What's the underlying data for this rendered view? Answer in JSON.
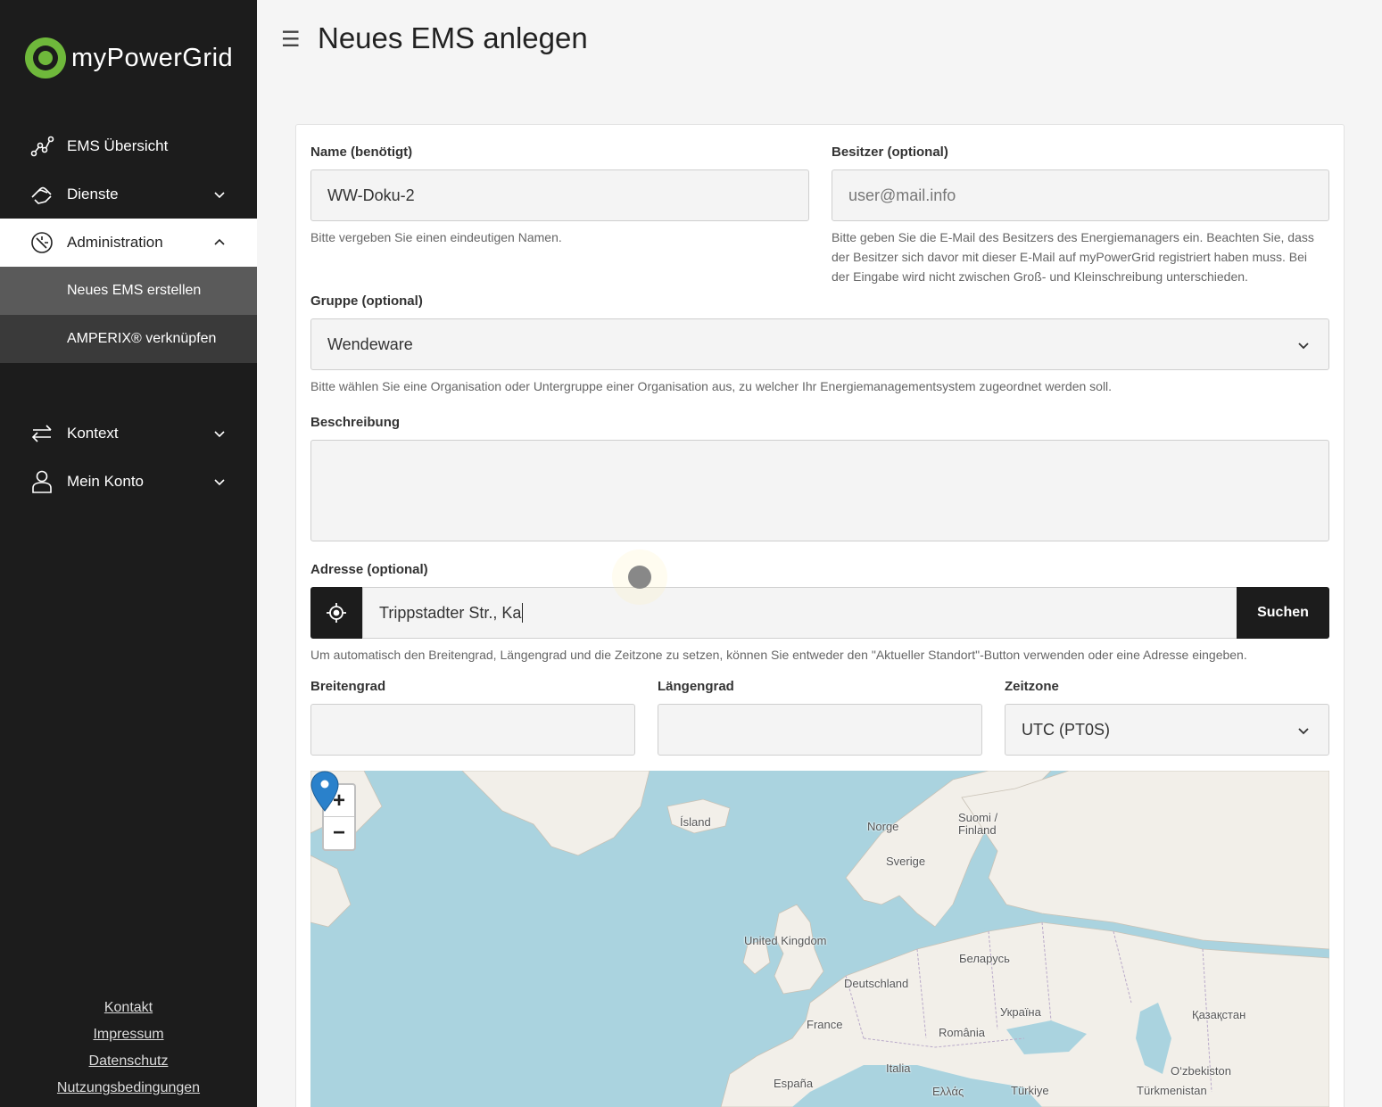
{
  "app": {
    "brand": "myPowerGrid"
  },
  "sidebar": {
    "items": [
      {
        "label": "EMS Übersicht"
      },
      {
        "label": "Dienste"
      },
      {
        "label": "Administration"
      },
      {
        "label": "Neues EMS erstellen"
      },
      {
        "label": "AMPERIX® verknüpfen"
      },
      {
        "label": "Kontext"
      },
      {
        "label": "Mein Konto"
      }
    ],
    "footer": [
      "Kontakt",
      "Impressum",
      "Datenschutz",
      "Nutzungsbedingungen"
    ]
  },
  "header": {
    "title": "Neues EMS anlegen"
  },
  "form": {
    "name": {
      "label": "Name (benötigt)",
      "value": "WW-Doku-2",
      "help": "Bitte vergeben Sie einen eindeutigen Namen."
    },
    "owner": {
      "label": "Besitzer (optional)",
      "placeholder": "user@mail.info",
      "help_lines": [
        "Bitte geben Sie die E-Mail des Besitzers des Energiemanagers ein. Beachten Sie, dass",
        "der Besitzer sich davor mit dieser E-Mail auf myPowerGrid registriert haben muss. Bei",
        "der Eingabe wird nicht zwischen Groß- und Kleinschreibung unterschieden."
      ]
    },
    "group": {
      "label": "Gruppe (optional)",
      "value": "Wendeware",
      "help": "Bitte wählen Sie eine Organisation oder Untergruppe einer Organisation aus, zu welcher Ihr Energiemanagementsystem zugeordnet werden soll."
    },
    "description": {
      "label": "Beschreibung",
      "value": ""
    },
    "address": {
      "label": "Adresse (optional)",
      "value": "Trippstadter Str., Ka",
      "search_label": "Suchen",
      "help": "Um automatisch den Breitengrad, Längengrad und die Zeitzone zu setzen, können Sie entweder den \"Aktueller Standort\"-Button verwenden oder eine Adresse eingeben."
    },
    "latitude": {
      "label": "Breitengrad",
      "value": ""
    },
    "longitude": {
      "label": "Längengrad",
      "value": ""
    },
    "timezone": {
      "label": "Zeitzone",
      "value": "UTC (PT0S)"
    }
  },
  "map": {
    "zoom_in": "+",
    "zoom_out": "−",
    "labels": [
      "Ísland",
      "Norge",
      "Suomi /",
      "Finland",
      "Sverige",
      "United Kingdom",
      "Беларусь",
      "Deutschland",
      "Україна",
      "Қазақстан",
      "France",
      "România",
      "Italia",
      "O‘zbekiston",
      "España",
      "Ελλάς",
      "Türkiye",
      "Türkmenistan"
    ]
  },
  "colors": {
    "sidebar_bg": "#1c1c1c",
    "accent": "#6fb83b",
    "water": "#aad3df",
    "land": "#f2efe9",
    "marker": "#2a81cb"
  }
}
